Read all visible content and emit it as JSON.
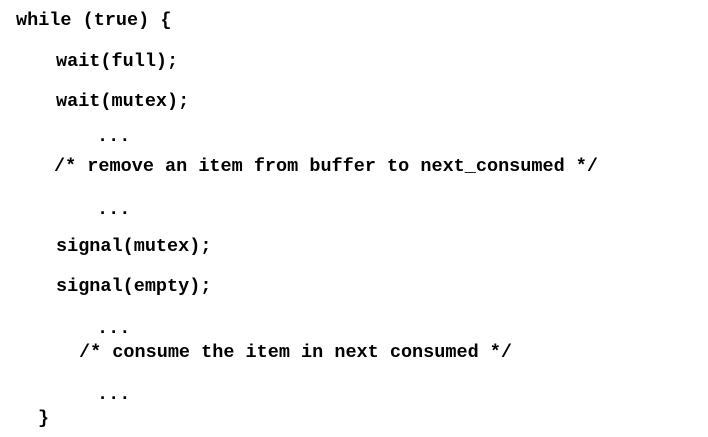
{
  "code": {
    "lines": [
      "while (true) {",
      "wait(full);",
      "wait(mutex);",
      "...",
      "/* remove an item from buffer to next_consumed */",
      "...",
      "signal(mutex);",
      "signal(empty);",
      "...",
      "/* consume the item in next consumed */",
      "...",
      "}"
    ]
  }
}
